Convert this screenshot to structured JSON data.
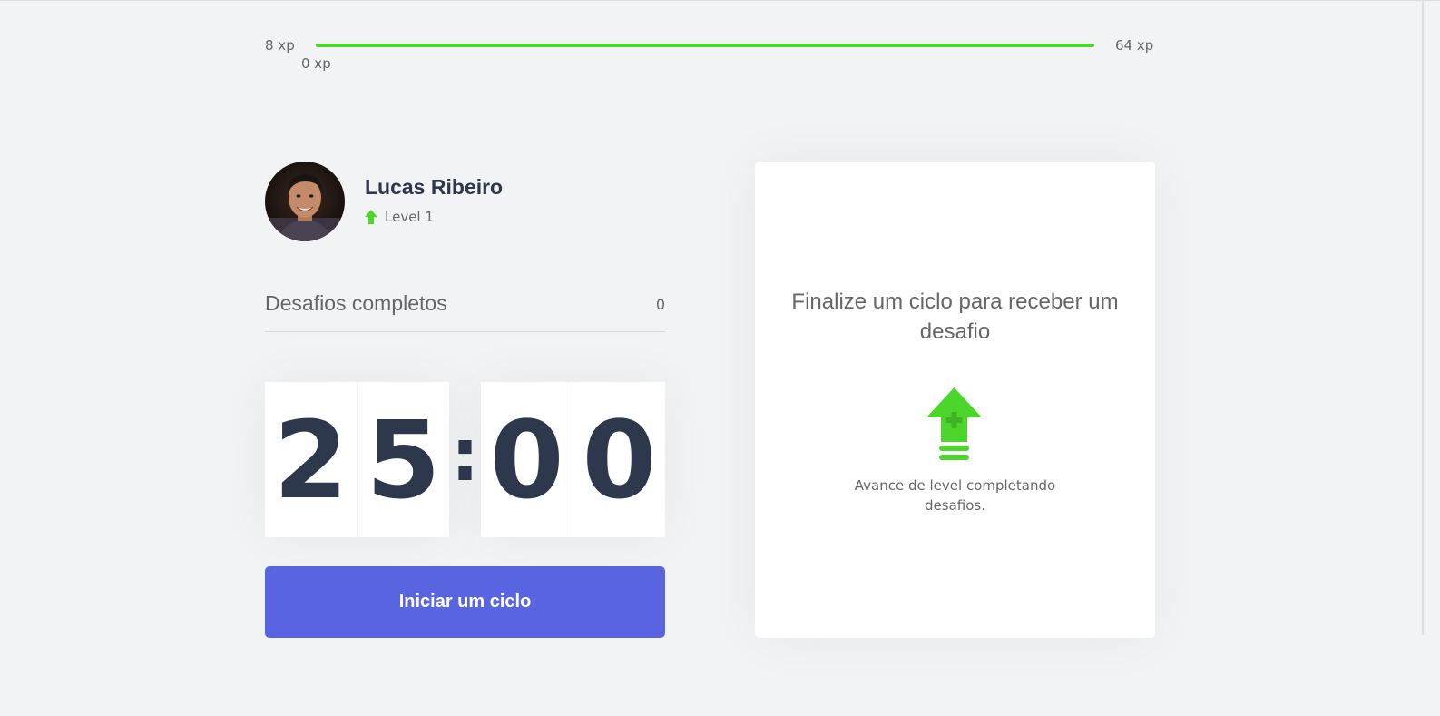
{
  "xp": {
    "min_label": "8 xp",
    "max_label": "64 xp",
    "current_label": "0 xp",
    "progress_fraction": 1.0
  },
  "profile": {
    "name": "Lucas Ribeiro",
    "level_label": "Level 1",
    "avatar_icon": "user-photo"
  },
  "challenges": {
    "completed_label": "Desafios completos",
    "completed_count": "0"
  },
  "countdown": {
    "minute_digits": [
      "2",
      "5"
    ],
    "separator": ":",
    "second_digits": [
      "0",
      "0"
    ]
  },
  "actions": {
    "start_label": "Iniciar um ciclo"
  },
  "challenge_box": {
    "title": "Finalize um ciclo para receber um desafio",
    "hint": "Avance de level completando desafios.",
    "icon": "level-up-icon"
  },
  "colors": {
    "background": "#f2f3f5",
    "accent_green": "#4cd62b",
    "button_blue": "#5965e0",
    "title_dark": "#2e384d",
    "text_gray": "#666666"
  }
}
